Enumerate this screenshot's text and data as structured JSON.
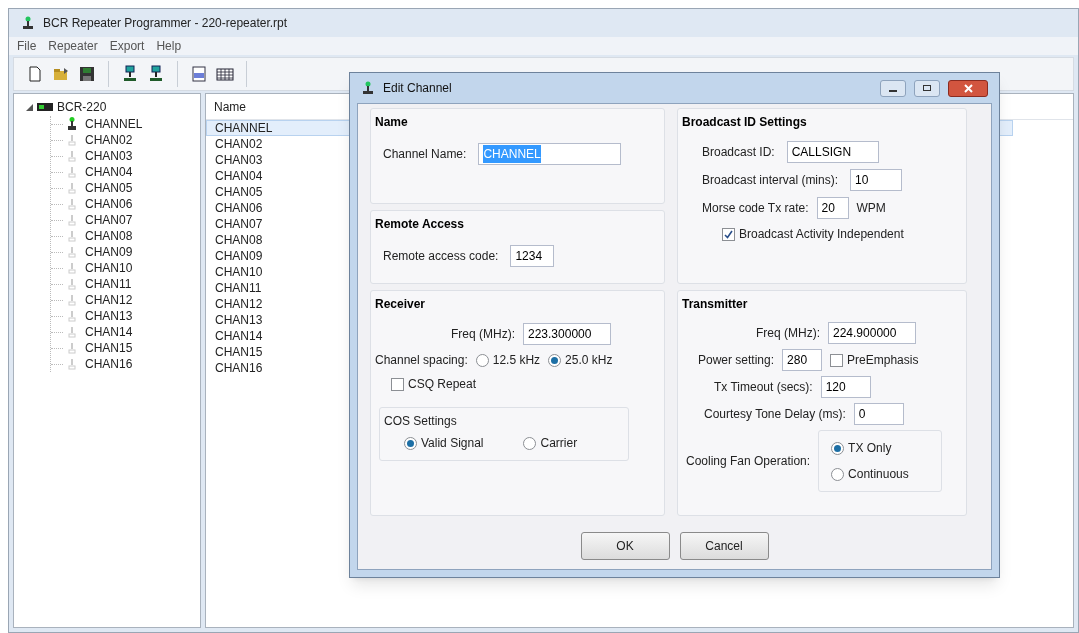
{
  "window": {
    "title": "BCR Repeater Programmer - 220-repeater.rpt"
  },
  "menu": [
    "File",
    "Repeater",
    "Export",
    "Help"
  ],
  "tree": {
    "label": "BCR-220",
    "expanded": true,
    "children": [
      {
        "label": "CHANNEL",
        "selected": true
      },
      {
        "label": "CHAN02",
        "selected": false
      },
      {
        "label": "CHAN03",
        "selected": false
      },
      {
        "label": "CHAN04",
        "selected": false
      },
      {
        "label": "CHAN05",
        "selected": false
      },
      {
        "label": "CHAN06",
        "selected": false
      },
      {
        "label": "CHAN07",
        "selected": false
      },
      {
        "label": "CHAN08",
        "selected": false
      },
      {
        "label": "CHAN09",
        "selected": false
      },
      {
        "label": "CHAN10",
        "selected": false
      },
      {
        "label": "CHAN11",
        "selected": false
      },
      {
        "label": "CHAN12",
        "selected": false
      },
      {
        "label": "CHAN13",
        "selected": false
      },
      {
        "label": "CHAN14",
        "selected": false
      },
      {
        "label": "CHAN15",
        "selected": false
      },
      {
        "label": "CHAN16",
        "selected": false
      }
    ]
  },
  "list": {
    "columns": [
      "Name"
    ],
    "rows": [
      {
        "name": "CHANNEL",
        "selected": true
      },
      {
        "name": "CHAN02",
        "selected": false
      },
      {
        "name": "CHAN03",
        "selected": false
      },
      {
        "name": "CHAN04",
        "selected": false
      },
      {
        "name": "CHAN05",
        "selected": false
      },
      {
        "name": "CHAN06",
        "selected": false
      },
      {
        "name": "CHAN07",
        "selected": false
      },
      {
        "name": "CHAN08",
        "selected": false
      },
      {
        "name": "CHAN09",
        "selected": false
      },
      {
        "name": "CHAN10",
        "selected": false
      },
      {
        "name": "CHAN11",
        "selected": false
      },
      {
        "name": "CHAN12",
        "selected": false
      },
      {
        "name": "CHAN13",
        "selected": false
      },
      {
        "name": "CHAN14",
        "selected": false
      },
      {
        "name": "CHAN15",
        "selected": false
      },
      {
        "name": "CHAN16",
        "selected": false
      }
    ]
  },
  "dialog": {
    "title": "Edit Channel",
    "name_group": {
      "title": "Name",
      "label": "Channel Name:",
      "value": "CHANNEL",
      "text_selected": true
    },
    "remote_group": {
      "title": "Remote Access",
      "label": "Remote access code:",
      "value": "1234"
    },
    "receiver": {
      "title": "Receiver",
      "freq_label": "Freq (MHz):",
      "freq": "223.300000",
      "spacing_label": "Channel spacing:",
      "spacing_options": [
        {
          "label": "12.5 kHz",
          "selected": false
        },
        {
          "label": "25.0 kHz",
          "selected": true
        }
      ],
      "csq_repeat": {
        "label": "CSQ Repeat",
        "checked": false
      },
      "cos": {
        "title": "COS Settings",
        "options": [
          {
            "label": "Valid Signal",
            "selected": true
          },
          {
            "label": "Carrier",
            "selected": false
          }
        ]
      }
    },
    "broadcast": {
      "title": "Broadcast ID Settings",
      "id_label": "Broadcast ID:",
      "id": "CALLSIGN",
      "interval_label": "Broadcast interval (mins):",
      "interval": "10",
      "rate_label": "Morse code Tx rate:",
      "rate": "20",
      "rate_unit": "WPM",
      "independent": {
        "label": "Broadcast Activity Independent",
        "checked": true
      }
    },
    "transmitter": {
      "title": "Transmitter",
      "freq_label": "Freq (MHz):",
      "freq": "224.900000",
      "power_label": "Power setting:",
      "power": "280",
      "pre_emphasis": {
        "label": "PreEmphasis",
        "checked": false
      },
      "timeout_label": "Tx Timeout (secs):",
      "timeout": "120",
      "delay_label": "Courtesy Tone Delay (ms):",
      "delay": "0",
      "fan_label": "Cooling Fan Operation:",
      "fan_options": [
        {
          "label": "TX Only",
          "selected": true
        },
        {
          "label": "Continuous",
          "selected": false
        }
      ]
    },
    "buttons": [
      "OK",
      "Cancel"
    ]
  }
}
